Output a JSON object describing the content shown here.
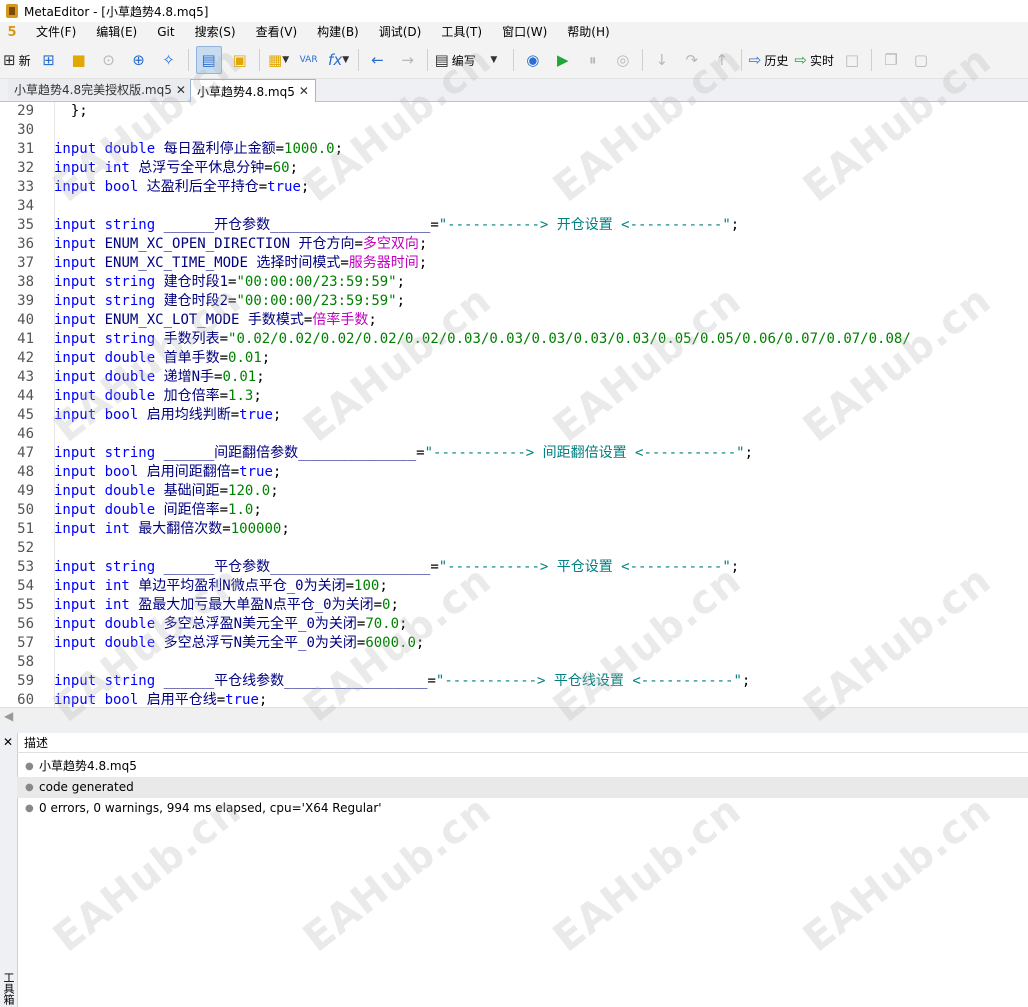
{
  "window": {
    "title": "MetaEditor - [小草趋势4.8.mq5]"
  },
  "menu": {
    "logo": "5",
    "items": [
      "文件(F)",
      "编辑(E)",
      "Git",
      "搜索(S)",
      "查看(V)",
      "构建(B)",
      "调试(D)",
      "工具(T)",
      "窗口(W)",
      "帮助(H)"
    ]
  },
  "toolbar": {
    "new_label": "新",
    "compile_label": "编写",
    "history_label": "历史",
    "realtime_label": "实时",
    "var_label": "VAR",
    "fx_label": "fx"
  },
  "tabs": [
    {
      "label": "小草趋势4.8完美授权版.mq5",
      "active": false
    },
    {
      "label": "小草趋势4.8.mq5",
      "active": true
    }
  ],
  "code": {
    "lines": [
      {
        "n": "29",
        "t": "  };"
      },
      {
        "n": "30",
        "t": ""
      },
      {
        "n": "31",
        "kw": "input double",
        "name": "每日盈利停止金额",
        "val": "1000.0",
        "end": ";"
      },
      {
        "n": "32",
        "kw": "input int",
        "name": "总浮亏全平休息分钟",
        "val": "60",
        "end": ";"
      },
      {
        "n": "33",
        "kw": "input bool",
        "name": "达盈利后全平持仓",
        "val": "true",
        "end": ";",
        "valtype": "kw"
      },
      {
        "n": "34",
        "t": ""
      },
      {
        "n": "35",
        "kw": "input string",
        "name": "______开仓参数___________________",
        "val": "\"-----------> 开仓设置 <-----------\"",
        "end": ";",
        "valtype": "st"
      },
      {
        "n": "36",
        "kw": "input",
        "enum": "ENUM_XC_OPEN_DIRECTION",
        "name": "开仓方向",
        "val": "多空双向",
        "end": ";",
        "valtype": "cm"
      },
      {
        "n": "37",
        "kw": "input",
        "enum": "ENUM_XC_TIME_MODE",
        "name": "选择时间模式",
        "val": "服务器时间",
        "end": ";",
        "valtype": "cm"
      },
      {
        "n": "38",
        "kw": "input string",
        "name": "建仓时段1",
        "val": "\"00:00:00/23:59:59\"",
        "end": ";",
        "valtype": "vl"
      },
      {
        "n": "39",
        "kw": "input string",
        "name": "建仓时段2",
        "val": "\"00:00:00/23:59:59\"",
        "end": ";",
        "valtype": "vl"
      },
      {
        "n": "40",
        "kw": "input",
        "enum": "ENUM_XC_LOT_MODE",
        "name": "手数模式",
        "val": "倍率手数",
        "end": ";",
        "valtype": "cm"
      },
      {
        "n": "41",
        "kw": "input string",
        "name": "手数列表",
        "val": "\"0.02/0.02/0.02/0.02/0.02/0.03/0.03/0.03/0.03/0.03/0.05/0.05/0.06/0.07/0.07/0.08/",
        "end": "",
        "valtype": "vl"
      },
      {
        "n": "42",
        "kw": "input double",
        "name": "首单手数",
        "val": "0.01",
        "end": ";"
      },
      {
        "n": "43",
        "kw": "input double",
        "name": "递增N手",
        "val": "0.01",
        "end": ";"
      },
      {
        "n": "44",
        "kw": "input double",
        "name": "加仓倍率",
        "val": "1.3",
        "end": ";"
      },
      {
        "n": "45",
        "kw": "input bool",
        "name": "启用均线判断",
        "val": "true",
        "end": ";",
        "valtype": "kw"
      },
      {
        "n": "46",
        "t": ""
      },
      {
        "n": "47",
        "kw": "input string",
        "name": "______间距翻倍参数______________",
        "val": "\"-----------> 间距翻倍设置 <-----------\"",
        "end": ";",
        "valtype": "st"
      },
      {
        "n": "48",
        "kw": "input bool",
        "name": "启用间距翻倍",
        "val": "true",
        "end": ";",
        "valtype": "kw"
      },
      {
        "n": "49",
        "kw": "input double",
        "name": "基础间距",
        "val": "120.0",
        "end": ";"
      },
      {
        "n": "50",
        "kw": "input double",
        "name": "间距倍率",
        "val": "1.0",
        "end": ";"
      },
      {
        "n": "51",
        "kw": "input int",
        "name": "最大翻倍次数",
        "val": "100000",
        "end": ";"
      },
      {
        "n": "52",
        "t": ""
      },
      {
        "n": "53",
        "kw": "input string",
        "name": "______平仓参数___________________",
        "val": "\"-----------> 平仓设置 <-----------\"",
        "end": ";",
        "valtype": "st"
      },
      {
        "n": "54",
        "kw": "input int",
        "name": "单边平均盈利N微点平仓_0为关闭",
        "val": "100",
        "end": ";"
      },
      {
        "n": "55",
        "kw": "input int",
        "name": "盈最大加亏最大单盈N点平仓_0为关闭",
        "val": "0",
        "end": ";"
      },
      {
        "n": "56",
        "kw": "input double",
        "name": "多空总浮盈N美元全平_0为关闭",
        "val": "70.0",
        "end": ";"
      },
      {
        "n": "57",
        "kw": "input double",
        "name": "多空总浮亏N美元全平_0为关闭",
        "val": "6000.0",
        "end": ";"
      },
      {
        "n": "58",
        "t": ""
      },
      {
        "n": "59",
        "kw": "input string",
        "name": "______平仓线参数_________________",
        "val": "\"-----------> 平仓线设置 <-----------\"",
        "end": ";",
        "valtype": "st"
      },
      {
        "n": "60",
        "kw": "input bool",
        "name": "启用平仓线",
        "val": "true",
        "end": ";",
        "valtype": "kw"
      }
    ]
  },
  "output": {
    "close": "✕",
    "side_label": "工具箱",
    "header": "描述",
    "rows": [
      "小草趋势4.8.mq5",
      "code generated",
      "0 errors, 0 warnings, 994 ms elapsed, cpu='X64 Regular'"
    ]
  },
  "watermark": "EAHub.cn"
}
